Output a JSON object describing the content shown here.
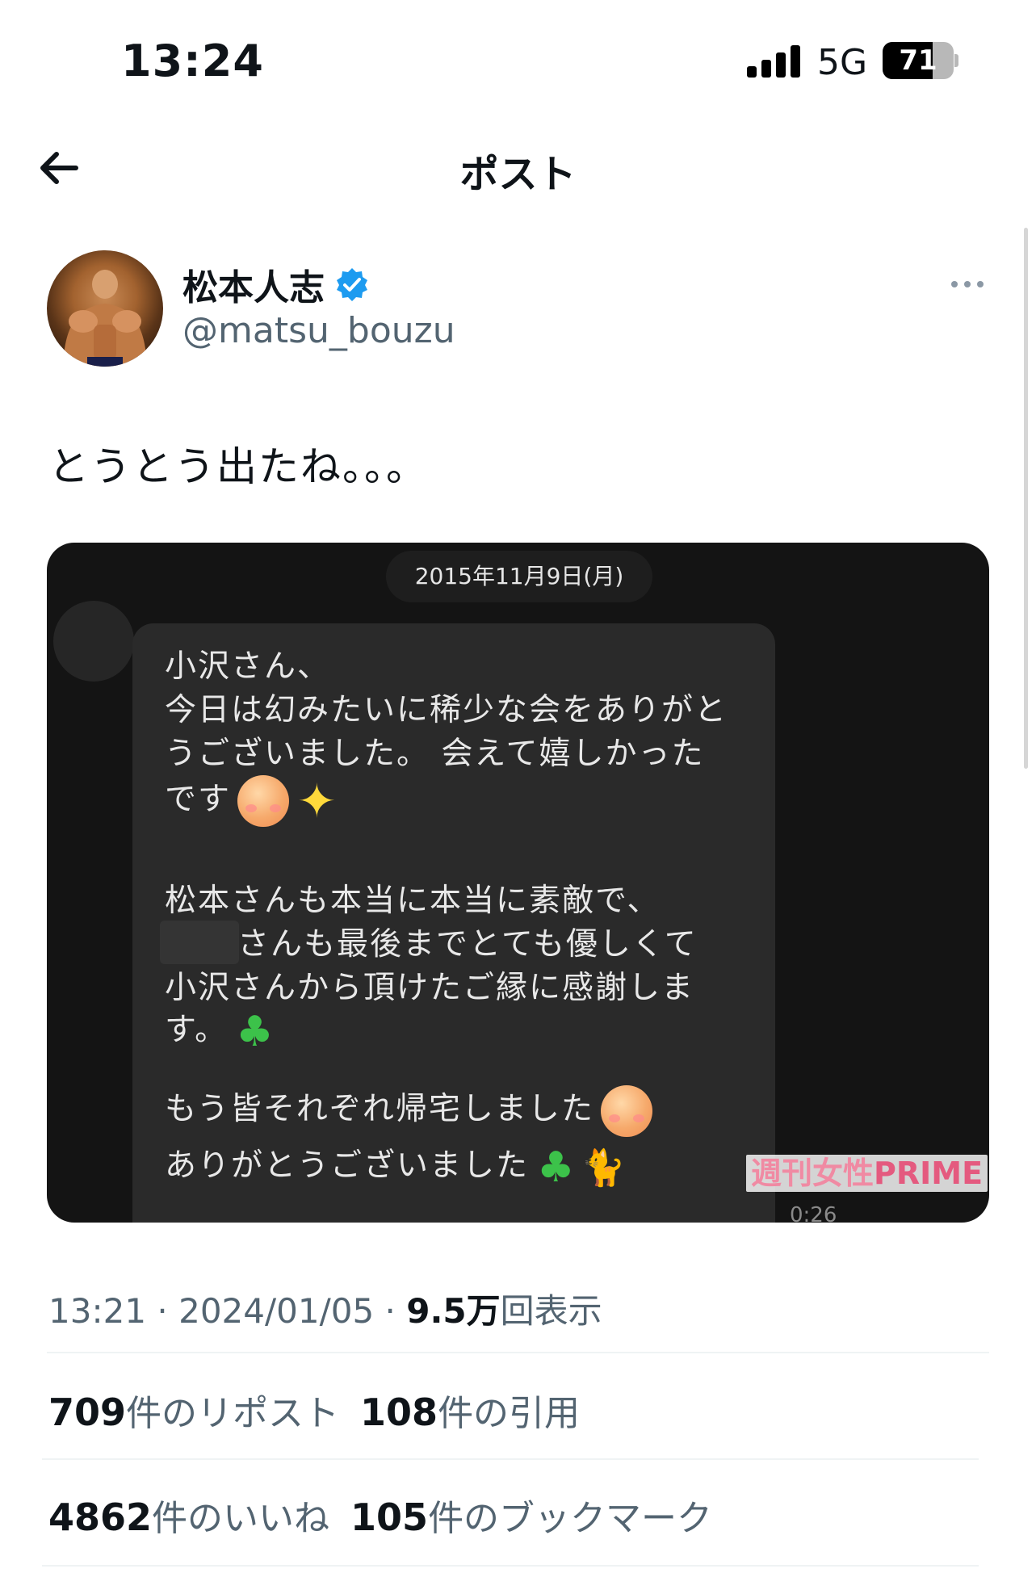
{
  "status_bar": {
    "time": "13:24",
    "network": "5G",
    "battery": "71",
    "battery_level": 0.71
  },
  "header": {
    "title": "ポスト"
  },
  "author": {
    "name": "松本人志",
    "handle": "@matsu_bouzu",
    "verified": true
  },
  "post": {
    "text": "とうとう出たね。。。"
  },
  "image": {
    "date": "2015年11月9日(月)",
    "lines": [
      "小沢さん、",
      "今日は幻みたいに稀少な会をありがと",
      "うございました。 会えて嬉しかった",
      "です",
      "松本さんも本当に本当に素敵で、",
      "さんも最後までとても優しくて",
      "小沢さんから頂けたご縁に感謝しま",
      "す。",
      "もう皆それぞれ帰宅しました",
      "ありがとうございました"
    ],
    "watermark_jp": "週刊女性",
    "watermark_en": "PRIME",
    "clip_time": "0:26"
  },
  "meta": {
    "time": "13:21",
    "date": "2024/01/05",
    "views": "9.5万",
    "views_label": "回表示",
    "sep": " · "
  },
  "stats": {
    "reposts": "709",
    "reposts_label": "件のリポスト",
    "quotes": "108",
    "quotes_label": "件の引用",
    "likes": "4862",
    "likes_label": "件のいいね",
    "bookmarks": "105",
    "bookmarks_label": "件のブックマーク"
  },
  "colors": {
    "verified": "#1d9bf0",
    "secondary_text": "#536471",
    "watermark": "#e45a7f"
  }
}
